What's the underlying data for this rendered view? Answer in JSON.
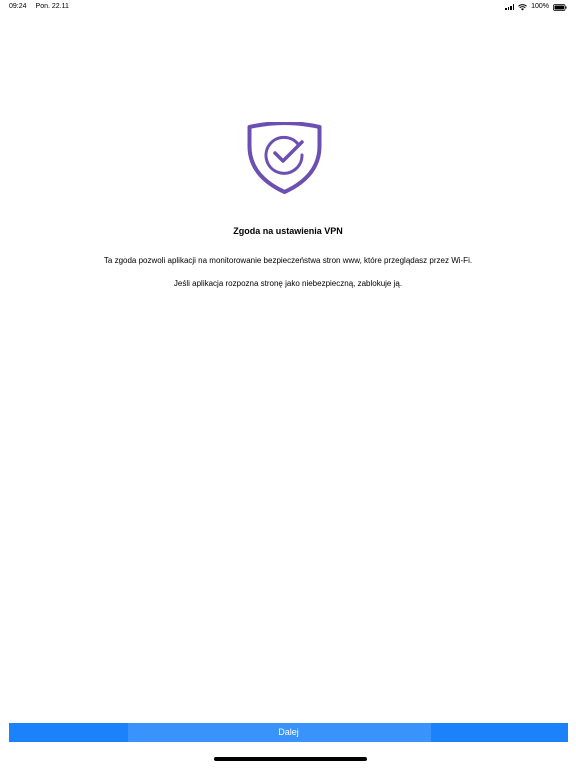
{
  "status_bar": {
    "time": "09:24",
    "date": "Pon. 22.11",
    "battery": "100%",
    "icons": [
      "signal-icon",
      "wifi-icon",
      "battery-icon"
    ]
  },
  "consent": {
    "icon": "shield-check-icon",
    "title": "Zgoda na ustawienia VPN",
    "description": "Ta zgoda pozwoli aplikacji na monitorowanie bezpieczeństwa stron www, które przeglądasz przez Wi-Fi.",
    "description_2": "Jeśli aplikacja rozpozna stronę jako niebezpieczną, zablokuje ją."
  },
  "footer": {
    "next_label": "Dalej"
  },
  "colors": {
    "accent": "#1a82fb",
    "shield": "#6b4fb3",
    "text": "#000000",
    "background": "#ffffff"
  }
}
